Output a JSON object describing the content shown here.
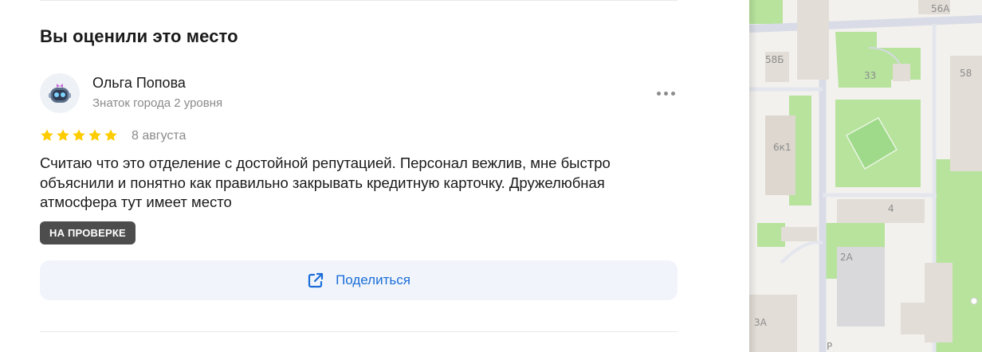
{
  "section": {
    "title": "Вы оценили это место"
  },
  "review": {
    "author_name": "Ольга Попова",
    "author_level": "Знаток города 2 уровня",
    "rating": 5,
    "rating_max": 5,
    "date": "8 августа",
    "text": "Считаю что это отделение с достойной репутацией. Персонал вежлив, мне быстро объяснили и понятно как правильно закрывать кредитную карточку. Дружелюбная атмосфера тут имеет место",
    "status": "НА ПРОВЕРКЕ"
  },
  "share": {
    "label": "Поделиться"
  },
  "map": {
    "labels": [
      "56А",
      "58Б",
      "33",
      "58",
      "6к1",
      "4",
      "2А",
      "3А",
      "Р"
    ]
  },
  "colors": {
    "accent": "#1a6dd8",
    "star": "#ffcc00",
    "badge_bg": "#4d4d4d",
    "share_bg": "#f1f5fb",
    "park": "#b7e39d"
  },
  "icons": {
    "avatar": "robot-avatar-icon",
    "more": "more-dots-icon",
    "star": "star-icon",
    "share": "share-external-icon"
  }
}
